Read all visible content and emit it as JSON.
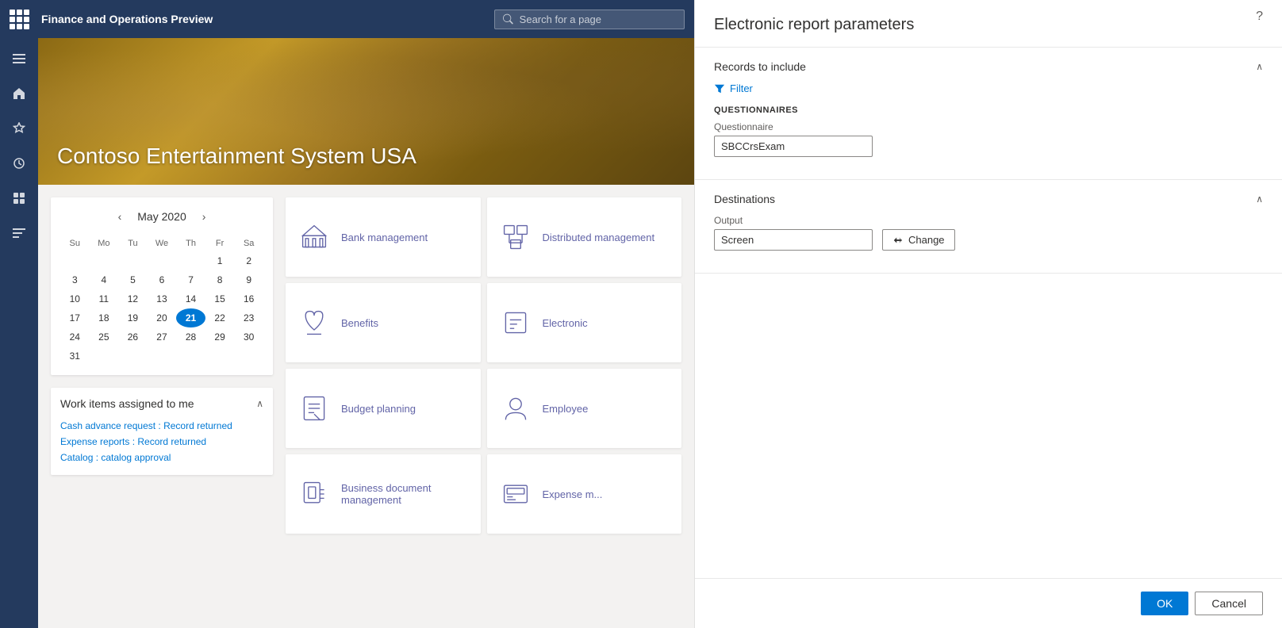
{
  "app": {
    "title": "Finance and Operations Preview",
    "search_placeholder": "Search for a page"
  },
  "hero": {
    "company_name": "Contoso Entertainment System USA"
  },
  "calendar": {
    "month": "May",
    "year": "2020",
    "today": 21,
    "days_header": [
      "Su",
      "Mo",
      "Tu",
      "We",
      "Th",
      "Fr",
      "Sa"
    ],
    "weeks": [
      [
        "",
        "",
        "",
        "",
        "",
        "1",
        "2"
      ],
      [
        "3",
        "4",
        "5",
        "6",
        "7",
        "8",
        "9"
      ],
      [
        "10",
        "11",
        "12",
        "13",
        "14",
        "15",
        "16"
      ],
      [
        "17",
        "18",
        "19",
        "20",
        "21",
        "22",
        "23"
      ],
      [
        "24",
        "25",
        "26",
        "27",
        "28",
        "29",
        "30"
      ],
      [
        "31",
        "",
        "",
        "",
        "",
        "",
        ""
      ]
    ]
  },
  "work_items": {
    "title": "Work items assigned to me",
    "items": [
      "Cash advance request : Record returned",
      "Expense reports : Record returned",
      "Catalog : catalog approval"
    ]
  },
  "modules": [
    {
      "id": "bank-management",
      "label": "Bank management",
      "icon": "bank"
    },
    {
      "id": "distributed-management",
      "label": "Distributed management",
      "icon": "distributed"
    },
    {
      "id": "benefits",
      "label": "Benefits",
      "icon": "benefits"
    },
    {
      "id": "electronic",
      "label": "Electronic",
      "icon": "electronic"
    },
    {
      "id": "budget-planning",
      "label": "Budget planning",
      "icon": "budget"
    },
    {
      "id": "employee",
      "label": "Employee",
      "icon": "employee"
    },
    {
      "id": "business-document-management",
      "label": "Business document management",
      "icon": "document"
    },
    {
      "id": "expense-management",
      "label": "Expense m...",
      "icon": "expense"
    }
  ],
  "report_panel": {
    "title": "Electronic report parameters",
    "records_section": {
      "title": "Records to include",
      "filter_label": "Filter",
      "questionnaires_label": "QUESTIONNAIRES",
      "questionnaire_field_label": "Questionnaire",
      "questionnaire_value": "SBCCrsExam"
    },
    "destinations_section": {
      "title": "Destinations",
      "output_label": "Output",
      "output_value": "Screen",
      "change_label": "Change"
    },
    "ok_label": "OK",
    "cancel_label": "Cancel"
  },
  "nav_icons": [
    {
      "id": "hamburger",
      "symbol": "☰"
    },
    {
      "id": "home",
      "symbol": "⌂"
    },
    {
      "id": "favorites",
      "symbol": "☆"
    },
    {
      "id": "recent",
      "symbol": "◷"
    },
    {
      "id": "workspaces",
      "symbol": "⊞"
    },
    {
      "id": "modules",
      "symbol": "☰"
    }
  ]
}
